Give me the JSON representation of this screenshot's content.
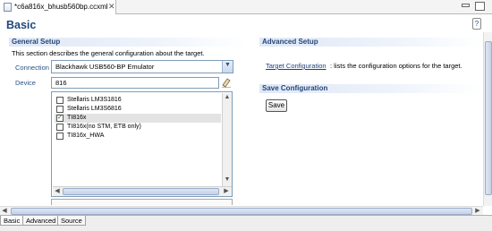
{
  "editor_tab": {
    "title": "*c6a816x_bhusb560bp.ccxml",
    "close": "✕"
  },
  "page": {
    "title": "Basic",
    "help": "?"
  },
  "general_setup": {
    "header": "General Setup",
    "description": "This section describes the general configuration about the target.",
    "connection_label": "Connection",
    "connection_value": "Blackhawk USB560-BP Emulator",
    "device_label": "Device",
    "device_value": "816",
    "devices": [
      {
        "label": "Stellaris LM3S1816",
        "checked": false,
        "selected": false
      },
      {
        "label": "Stellaris LM3S6816",
        "checked": false,
        "selected": false
      },
      {
        "label": "TI816x",
        "checked": true,
        "selected": true
      },
      {
        "label": "TI816x(no STM, ETB only)",
        "checked": false,
        "selected": false
      },
      {
        "label": "TI816x_HWA",
        "checked": false,
        "selected": false
      }
    ],
    "scroll": {
      "left": "◀",
      "right": "▶",
      "up": "▲",
      "down": "▼"
    }
  },
  "advanced_setup": {
    "header": "Advanced Setup",
    "link": "Target Configuration",
    "description": ": lists the configuration options for the target."
  },
  "save_configuration": {
    "header": "Save Configuration",
    "button": "Save"
  },
  "bottom_tabs": [
    {
      "label": "Basic",
      "active": true
    },
    {
      "label": "Advanced",
      "active": false
    },
    {
      "label": "Source",
      "active": false
    }
  ],
  "colors": {
    "section_header": "#27467a",
    "title": "#1f477c",
    "header_gradient": "#dfe8f6",
    "check": "#1d6b1d"
  },
  "icons": {
    "file": "xml-file-icon",
    "clear": "eraser-icon",
    "dropdown": "chevron-down-icon"
  }
}
